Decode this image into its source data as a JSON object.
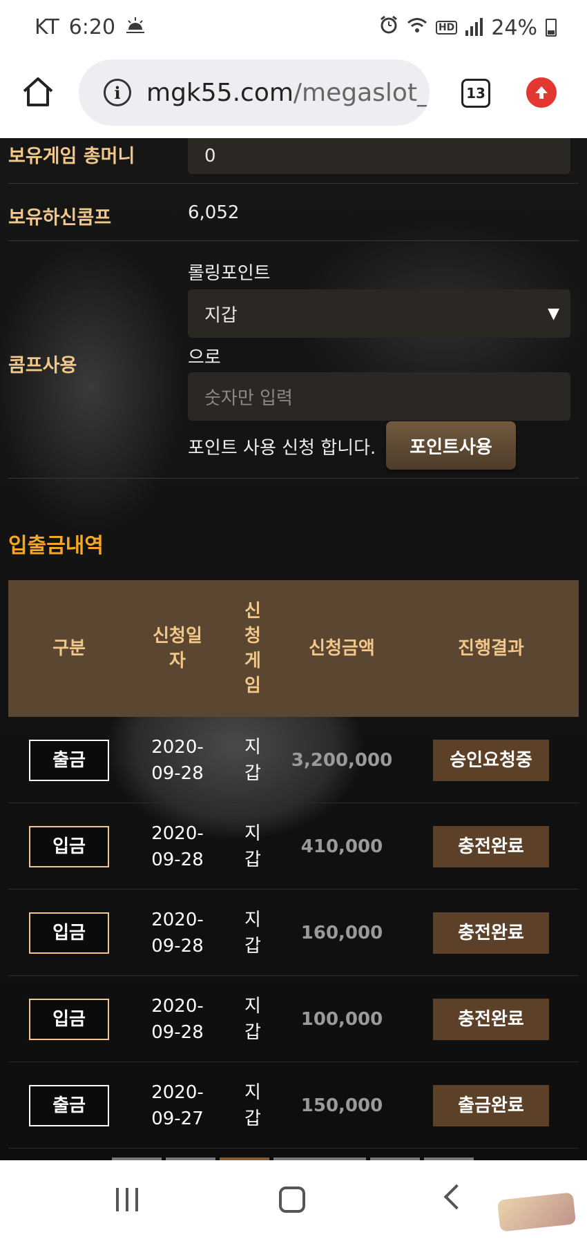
{
  "status_bar": {
    "carrier": "KT",
    "time": "6:20",
    "battery": "24%",
    "hd_label": "HD"
  },
  "browser": {
    "url_host": "mgk55.com",
    "url_path": "/megaslot_",
    "tab_count": "13"
  },
  "form": {
    "total_money_label": "보유게임 총머니",
    "total_money_value": "0",
    "comp_label": "보유하신콤프",
    "comp_value": "6,052",
    "use_label": "콤프사용",
    "rolling_point_label": "롤링포인트",
    "wallet_select": "지갑",
    "to_text": "으로",
    "amount_placeholder": "숫자만 입력",
    "request_text": "포인트 사용 신청 합니다.",
    "use_point_button": "포인트사용"
  },
  "history": {
    "title": "입출금내역",
    "headers": [
      "구분",
      "신청일\n자",
      "신\n청\n게\n임",
      "신청금액",
      "진행결과"
    ],
    "rows": [
      {
        "type": "출금",
        "kind": "withdraw",
        "date": "2020-\n09-28",
        "game": "지\n갑",
        "amount": "3,200,000",
        "status": "승인요청중"
      },
      {
        "type": "입금",
        "kind": "deposit",
        "date": "2020-\n09-28",
        "game": "지\n갑",
        "amount": "410,000",
        "status": "충전완료"
      },
      {
        "type": "입금",
        "kind": "deposit",
        "date": "2020-\n09-28",
        "game": "지\n갑",
        "amount": "160,000",
        "status": "충전완료"
      },
      {
        "type": "입금",
        "kind": "deposit",
        "date": "2020-\n09-28",
        "game": "지\n갑",
        "amount": "100,000",
        "status": "충전완료"
      },
      {
        "type": "출금",
        "kind": "withdraw",
        "date": "2020-\n09-27",
        "game": "지\n갑",
        "amount": "150,000",
        "status": "출금완료"
      }
    ]
  },
  "colors": {
    "accent_orange": "#f5a623",
    "label_gold": "#f2c78a",
    "header_brown": "#5a4631",
    "status_brown": "#5c4128"
  }
}
